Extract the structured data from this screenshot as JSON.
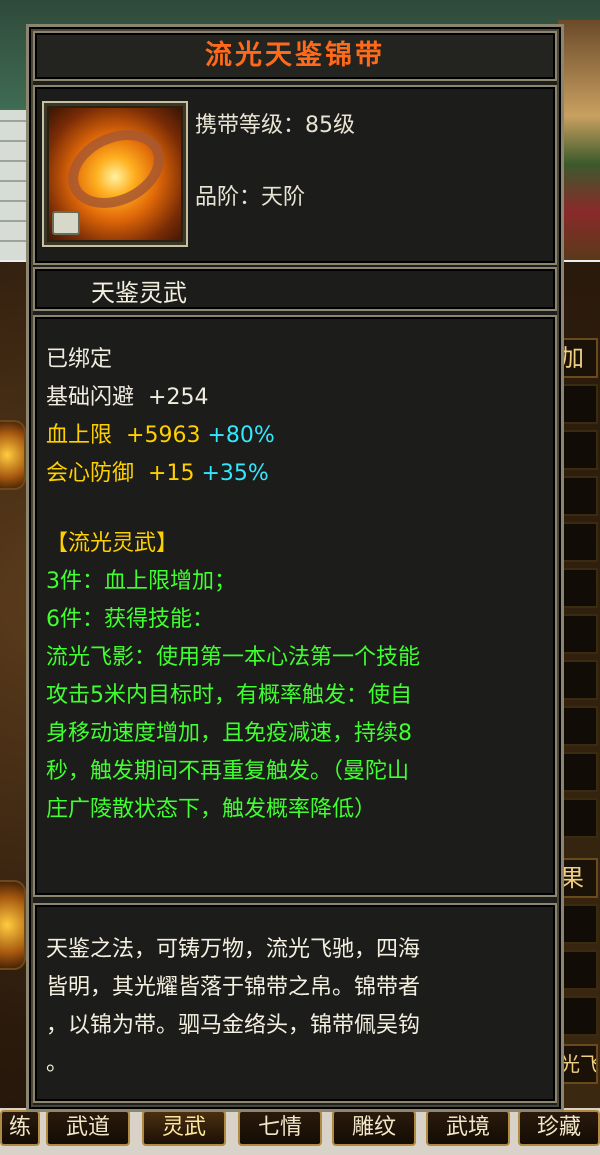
{
  "item": {
    "name": "流光天鉴锦带",
    "level_label": "携带等级：85级",
    "grade_label": "品阶：天阶",
    "category": "天鉴灵武"
  },
  "stats": {
    "bound": "已绑定",
    "dodge": {
      "label": "基础闪避",
      "value": "+254"
    },
    "hp": {
      "label": "血上限",
      "value": "+5963",
      "bonus": "+80%"
    },
    "crit_def": {
      "label": "会心防御",
      "value": "+15",
      "bonus": "+35%"
    }
  },
  "set": {
    "title": "【流光灵武】",
    "lines": [
      "3件：血上限增加；",
      "6件：获得技能：",
      "流光飞影：使用第一本心法第一个技能",
      "攻击5米内目标时，有概率触发：使自",
      "身移动速度增加，且免疫减速，持续8",
      "秒，触发期间不再重复触发。（曼陀山",
      "庄广陵散状态下，触发概率降低）"
    ]
  },
  "description": {
    "lines": [
      "天鉴之法，可铸万物，流光飞驰，四海",
      "皆明，其光耀皆落于锦带之帛。锦带者",
      "，以锦为带。驷马金络头，锦带佩吴钩",
      "。"
    ]
  },
  "side_tabs": {
    "top": "加",
    "bottom": "果",
    "lower": "光飞"
  },
  "bottom_tabs": [
    "练",
    "武道",
    "灵武",
    "七情",
    "雕纹",
    "武境",
    "珍藏"
  ],
  "colors": {
    "title": "#ff6a1a",
    "stat_white": "#f0ece0",
    "stat_yellow": "#ffd000",
    "stat_cyan": "#30e8ff",
    "set_green": "#40ff30"
  }
}
